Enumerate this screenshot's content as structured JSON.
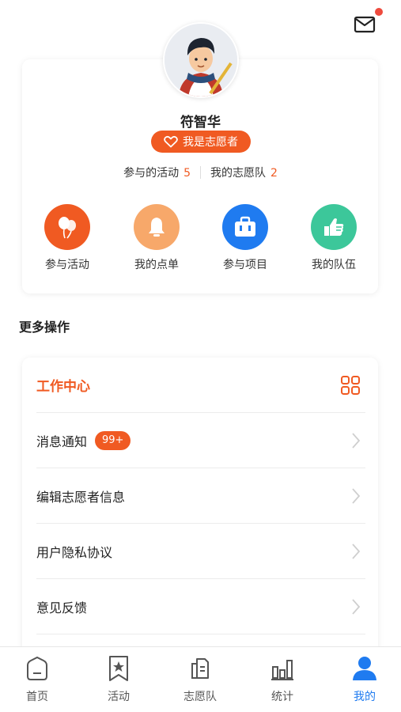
{
  "header": {
    "notification_dot": true
  },
  "profile": {
    "name": "符智华",
    "badge_label": "我是志愿者",
    "stats": [
      {
        "label": "参与的活动",
        "value": "5"
      },
      {
        "label": "我的志愿队",
        "value": "2"
      }
    ]
  },
  "quick_actions": [
    {
      "label": "参与活动",
      "icon": "balloon-icon",
      "color": "#f05a22"
    },
    {
      "label": "我的点单",
      "icon": "bell-icon",
      "color": "#f7a86a"
    },
    {
      "label": "参与项目",
      "icon": "briefcase-icon",
      "color": "#1f7bf0"
    },
    {
      "label": "我的队伍",
      "icon": "hand-icon",
      "color": "#3cc79a"
    }
  ],
  "more": {
    "section_title": "更多操作",
    "work_center": "工作中心",
    "items": [
      {
        "label": "消息通知",
        "badge": "99+"
      },
      {
        "label": "编辑志愿者信息"
      },
      {
        "label": "用户隐私协议"
      },
      {
        "label": "意见反馈"
      }
    ]
  },
  "tabbar": {
    "tabs": [
      {
        "label": "首页",
        "icon": "home-icon",
        "active": false
      },
      {
        "label": "活动",
        "icon": "star-bookmark-icon",
        "active": false
      },
      {
        "label": "志愿队",
        "icon": "team-doc-icon",
        "active": false
      },
      {
        "label": "统计",
        "icon": "bar-chart-icon",
        "active": false
      },
      {
        "label": "我的",
        "icon": "user-icon",
        "active": true
      }
    ]
  },
  "colors": {
    "accent": "#f05a22",
    "active_tab": "#1f7bf0"
  }
}
